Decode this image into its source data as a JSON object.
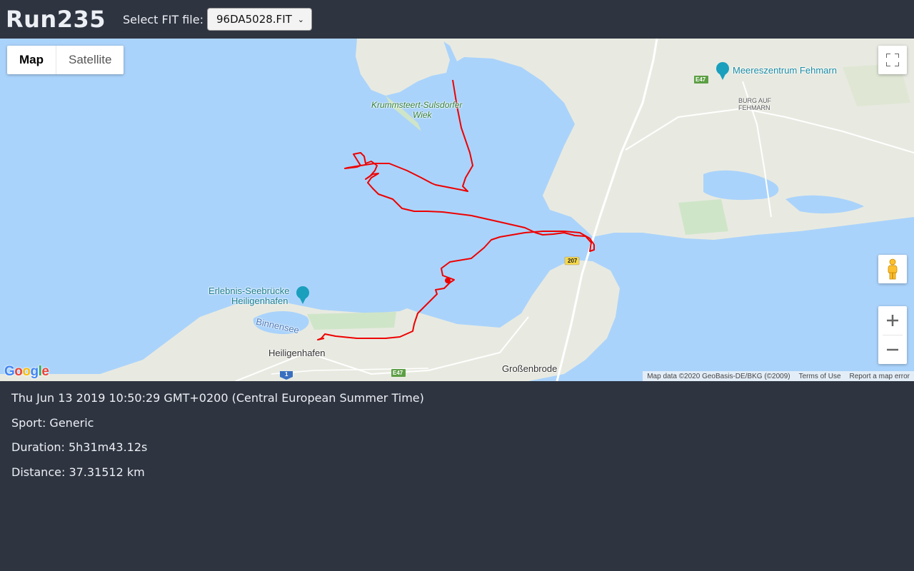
{
  "app": {
    "title": "Run235"
  },
  "file_select": {
    "label": "Select FIT file:",
    "value": "96DA5028.FIT"
  },
  "map": {
    "type_buttons": [
      "Map",
      "Satellite"
    ],
    "active_type": "Map",
    "labels": {
      "krummsteert": "Krummsteert-Sulsdorfer",
      "krummsteert_2": "Wiek",
      "meereszentrum": "Meereszentrum Fehmarn",
      "burg": "BURG AUF",
      "burg_2": "FEHMARN",
      "seebruecke": "Erlebnis-Seebrücke",
      "seebruecke_2": "Heiligenhafen",
      "binnensee": "Binnensee",
      "heiligenhafen": "Heiligenhafen",
      "grossenbrode": "Großenbrode"
    },
    "road_shields": {
      "e47_top": "E47",
      "e47_bottom": "E47",
      "b207": "207",
      "a1": "1"
    },
    "attribution": {
      "map_data": "Map data ©2020 GeoBasis-DE/BKG (©2009)",
      "terms": "Terms of Use",
      "report": "Report a map error"
    },
    "logo_text": "Google",
    "colors": {
      "water": "#aad3fb",
      "land": "#e8eae1",
      "track": "#ee0000"
    }
  },
  "activity": {
    "start_time": "Thu Jun 13 2019 10:50:29 GMT+0200 (Central European Summer Time)",
    "sport": "Sport: Generic",
    "duration": "Duration: 5h31m43.12s",
    "distance": "Distance: 37.31512 km"
  }
}
